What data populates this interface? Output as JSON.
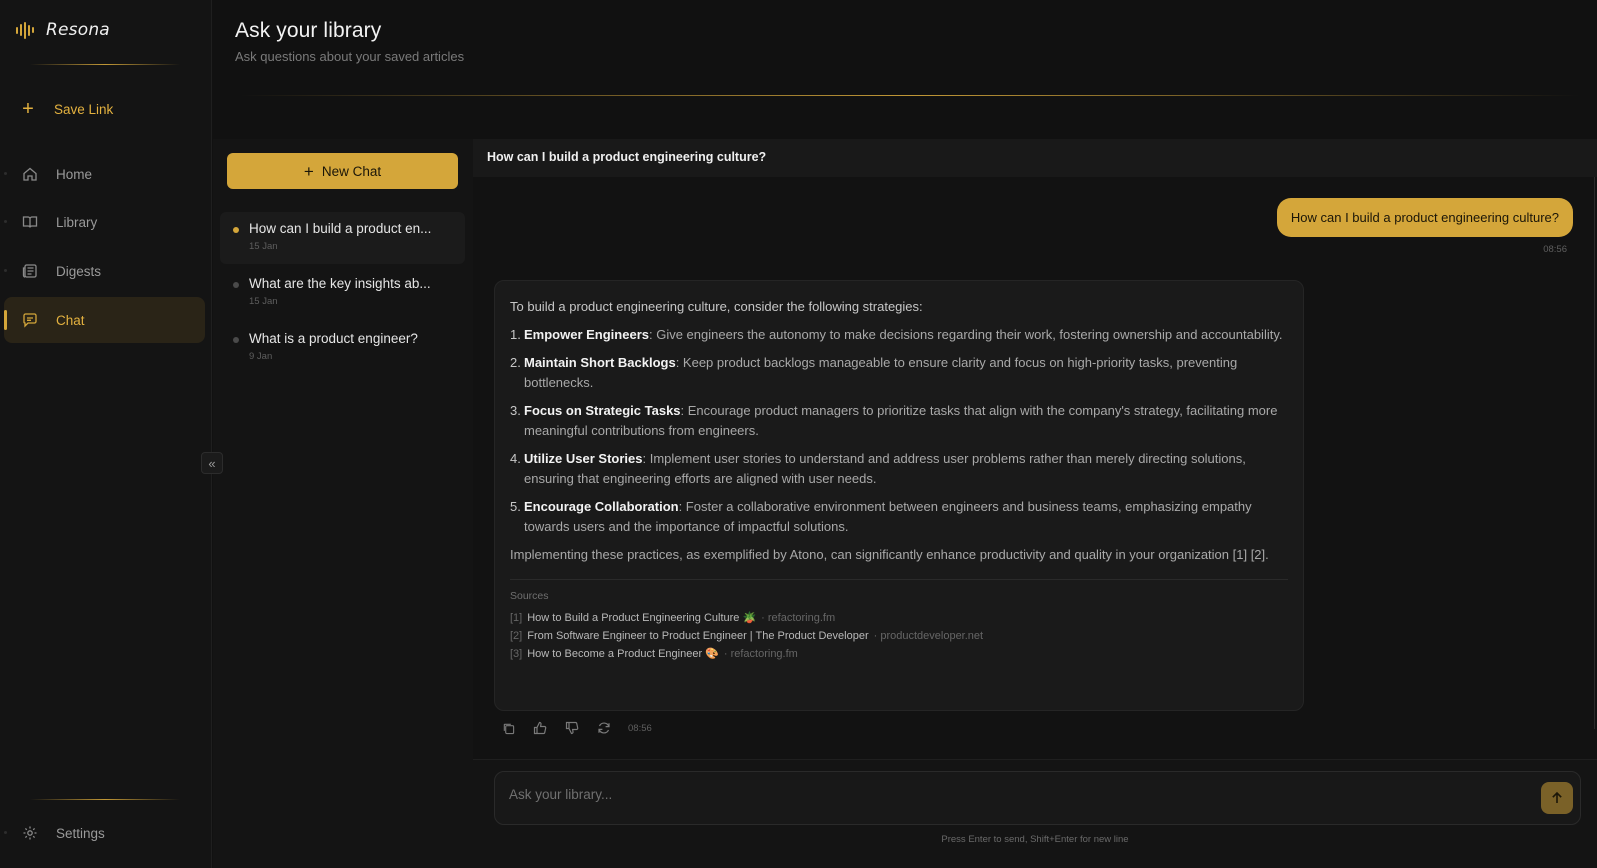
{
  "brand": {
    "name": "Resona",
    "accent": "#d4a63a"
  },
  "sidebar": {
    "save_link": "Save Link",
    "items": [
      {
        "label": "Home",
        "icon": "home-icon"
      },
      {
        "label": "Library",
        "icon": "book-icon"
      },
      {
        "label": "Digests",
        "icon": "newspaper-icon"
      },
      {
        "label": "Chat",
        "icon": "chat-icon",
        "active": true
      }
    ],
    "settings": "Settings"
  },
  "header": {
    "title": "Ask your library",
    "subtitle": "Ask questions about your saved articles"
  },
  "chat_list": {
    "new_chat_label": "New Chat",
    "items": [
      {
        "title": "How can I build a product en...",
        "date": "15 Jan",
        "active": true
      },
      {
        "title": "What are the key insights ab...",
        "date": "15 Jan"
      },
      {
        "title": "What is a product engineer?",
        "date": "9 Jan"
      }
    ]
  },
  "conversation": {
    "title": "How can I build a product engineering culture?",
    "user_message": {
      "text": "How can I build a product engineering culture?",
      "time": "08:56"
    },
    "answer": {
      "intro": "To build a product engineering culture, consider the following strategies:",
      "points": [
        {
          "num": "1.",
          "title": "Empower Engineers",
          "text": ": Give engineers the autonomy to make decisions regarding their work, fostering ownership and accountability."
        },
        {
          "num": "2.",
          "title": "Maintain Short Backlogs",
          "text": ": Keep product backlogs manageable to ensure clarity and focus on high-priority tasks, preventing bottlenecks."
        },
        {
          "num": "3.",
          "title": "Focus on Strategic Tasks",
          "text": ": Encourage product managers to prioritize tasks that align with the company's strategy, facilitating more meaningful contributions from engineers."
        },
        {
          "num": "4.",
          "title": "Utilize User Stories",
          "text": ": Implement user stories to understand and address user problems rather than merely directing solutions, ensuring that engineering efforts are aligned with user needs."
        },
        {
          "num": "5.",
          "title": "Encourage Collaboration",
          "text": ": Foster a collaborative environment between engineers and business teams, emphasizing empathy towards users and the importance of impactful solutions."
        }
      ],
      "outro": "Implementing these practices, as exemplified by Atono, can significantly enhance productivity and quality in your organization [1] [2].",
      "sources_label": "Sources",
      "sources": [
        {
          "index": "[1]",
          "title": "How to Build a Product Engineering Culture 🪴",
          "domain": "· refactoring.fm"
        },
        {
          "index": "[2]",
          "title": "From Software Engineer to Product Engineer | The Product Developer",
          "domain": "· productdeveloper.net"
        },
        {
          "index": "[3]",
          "title": "How to Become a Product Engineer 🎨",
          "domain": "· refactoring.fm"
        }
      ],
      "time": "08:56"
    }
  },
  "composer": {
    "placeholder": "Ask your library...",
    "hint": "Press Enter to send, Shift+Enter for new line"
  }
}
